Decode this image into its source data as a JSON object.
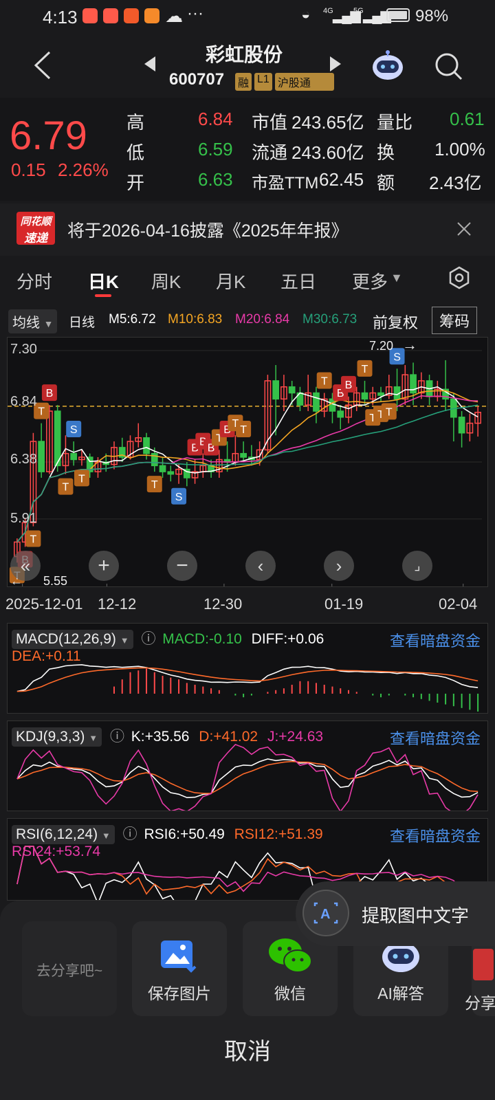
{
  "status_bar": {
    "time": "4:13",
    "dots": "···",
    "net_4g": "4G",
    "net_5g": "5G",
    "battery": "98%"
  },
  "header": {
    "stock_name": "彩虹股份",
    "stock_code": "600707",
    "badges": [
      "融",
      "L1",
      "沪股通"
    ]
  },
  "quote": {
    "price": "6.79",
    "change": "0.15",
    "change_pct": "2.26%",
    "high_label": "高",
    "high": "6.84",
    "low_label": "低",
    "low": "6.59",
    "open_label": "开",
    "open": "6.63",
    "mktcap_label": "市值",
    "mktcap": "243.65亿",
    "float_label": "流通",
    "float": "243.60亿",
    "pe_label": "市盈TTM",
    "pe": "62.45",
    "vol_ratio_label": "量比",
    "vol_ratio": "0.61",
    "turnover_label": "换",
    "turnover": "1.00%",
    "amount_label": "额",
    "amount": "2.43亿"
  },
  "notice": {
    "logo_top": "同花顺",
    "logo_bottom": "速递",
    "text": "将于2026-04-16披露《2025年年报》"
  },
  "tabs": [
    "分时",
    "日K",
    "周K",
    "月K",
    "五日",
    "更多"
  ],
  "ma_bar": {
    "type": "均线",
    "period": "日线",
    "m5": "M5:6.72",
    "m10": "M10:6.83",
    "m20": "M20:6.84",
    "m30": "M30:6.73",
    "adjust": "前复权",
    "chips": "筹码"
  },
  "colors": {
    "up": "#ff4a4a",
    "down": "#35c04a",
    "m5": "#ffffff",
    "m10": "#f5a623",
    "m20": "#e83aa8",
    "m30": "#26a07a",
    "link": "#4a8fe8"
  },
  "chart_data": {
    "type": "candlestick",
    "y_ticks": [
      "7.30",
      "6.84",
      "6.38",
      "5.91",
      "5.55"
    ],
    "ylim": [
      5.45,
      7.35
    ],
    "x_ticks": [
      "2025-12-01",
      "12-12",
      "12-30",
      "01-19",
      "02-04"
    ],
    "high_annot": "7.20",
    "low_annot": "5.55",
    "ref_line": 6.84,
    "candles": [
      [
        5.6,
        5.72,
        5.55,
        5.75
      ],
      [
        5.72,
        5.88,
        5.68,
        5.92
      ],
      [
        5.88,
        6.55,
        5.85,
        6.62
      ],
      [
        6.55,
        6.3,
        6.25,
        6.7
      ],
      [
        6.3,
        6.8,
        6.28,
        6.85
      ],
      [
        6.8,
        6.35,
        6.3,
        6.85
      ],
      [
        6.35,
        6.45,
        6.28,
        6.6
      ],
      [
        6.45,
        6.4,
        6.35,
        6.55
      ],
      [
        6.4,
        6.42,
        6.35,
        6.48
      ],
      [
        6.42,
        6.3,
        6.25,
        6.45
      ],
      [
        6.3,
        6.38,
        6.25,
        6.42
      ],
      [
        6.38,
        6.36,
        6.3,
        6.45
      ],
      [
        6.36,
        6.5,
        6.32,
        6.55
      ],
      [
        6.5,
        6.42,
        6.38,
        6.58
      ],
      [
        6.42,
        6.55,
        6.4,
        6.6
      ],
      [
        6.55,
        6.58,
        6.5,
        6.7
      ],
      [
        6.58,
        6.45,
        6.4,
        6.62
      ],
      [
        6.45,
        6.35,
        6.3,
        6.5
      ],
      [
        6.35,
        6.3,
        6.25,
        6.42
      ],
      [
        6.3,
        6.28,
        6.22,
        6.35
      ],
      [
        6.28,
        6.32,
        6.2,
        6.36
      ],
      [
        6.32,
        6.25,
        6.18,
        6.38
      ],
      [
        6.25,
        6.3,
        6.2,
        6.4
      ],
      [
        6.3,
        6.35,
        6.25,
        6.45
      ],
      [
        6.35,
        6.3,
        6.25,
        6.4
      ],
      [
        6.3,
        6.4,
        6.25,
        6.48
      ],
      [
        6.4,
        6.38,
        6.3,
        6.55
      ],
      [
        6.38,
        6.45,
        6.35,
        6.6
      ],
      [
        6.45,
        6.42,
        6.38,
        6.55
      ],
      [
        6.42,
        6.4,
        6.35,
        6.52
      ],
      [
        6.4,
        6.48,
        6.35,
        6.55
      ],
      [
        6.48,
        7.05,
        6.45,
        7.1
      ],
      [
        7.05,
        6.9,
        6.6,
        7.18
      ],
      [
        6.9,
        7.0,
        6.8,
        7.1
      ],
      [
        7.0,
        6.95,
        6.85,
        7.05
      ],
      [
        6.95,
        6.85,
        6.8,
        7.0
      ],
      [
        6.85,
        6.95,
        6.8,
        7.1
      ],
      [
        6.95,
        6.8,
        6.7,
        7.0
      ],
      [
        6.8,
        6.9,
        6.75,
        6.95
      ],
      [
        6.9,
        6.8,
        6.7,
        6.95
      ],
      [
        6.8,
        6.75,
        6.65,
        6.85
      ],
      [
        6.75,
        6.85,
        6.7,
        6.92
      ],
      [
        6.85,
        6.95,
        6.8,
        7.0
      ],
      [
        6.95,
        6.9,
        6.85,
        7.05
      ],
      [
        6.9,
        6.95,
        6.85,
        7.0
      ],
      [
        6.95,
        6.93,
        6.88,
        7.0
      ],
      [
        6.93,
        7.0,
        6.9,
        7.1
      ],
      [
        7.0,
        6.9,
        6.8,
        7.15
      ],
      [
        6.9,
        7.1,
        6.85,
        7.18
      ],
      [
        7.1,
        6.95,
        6.85,
        7.2
      ],
      [
        6.95,
        7.05,
        6.9,
        7.12
      ],
      [
        7.05,
        6.92,
        6.85,
        7.1
      ],
      [
        6.92,
        6.98,
        6.88,
        7.05
      ],
      [
        6.98,
        6.9,
        6.8,
        7.22
      ],
      [
        6.9,
        6.75,
        6.55,
        6.95
      ],
      [
        6.75,
        6.62,
        6.5,
        6.8
      ],
      [
        6.62,
        6.7,
        6.55,
        6.78
      ],
      [
        6.7,
        6.79,
        6.59,
        6.84
      ]
    ],
    "markers": [
      {
        "label": "T",
        "i": 0,
        "pos": "below"
      },
      {
        "label": "B",
        "i": 1,
        "pos": "below"
      },
      {
        "label": "T",
        "i": 2,
        "pos": "below"
      },
      {
        "label": "T",
        "i": 3,
        "pos": "above"
      },
      {
        "label": "B",
        "i": 4,
        "pos": "above"
      },
      {
        "label": "T",
        "i": 6,
        "pos": "below"
      },
      {
        "label": "S",
        "i": 7,
        "pos": "above"
      },
      {
        "label": "T",
        "i": 8,
        "pos": "below"
      },
      {
        "label": "T",
        "i": 17,
        "pos": "below"
      },
      {
        "label": "S",
        "i": 20,
        "pos": "below"
      },
      {
        "label": "B",
        "i": 22,
        "pos": "above"
      },
      {
        "label": "B",
        "i": 23,
        "pos": "above"
      },
      {
        "label": "B",
        "i": 24,
        "pos": "above"
      },
      {
        "label": "T",
        "i": 25,
        "pos": "above"
      },
      {
        "label": "B",
        "i": 26,
        "pos": "above"
      },
      {
        "label": "T",
        "i": 27,
        "pos": "above"
      },
      {
        "label": "T",
        "i": 28,
        "pos": "above"
      },
      {
        "label": "T",
        "i": 38,
        "pos": "above"
      },
      {
        "label": "B",
        "i": 40,
        "pos": "above"
      },
      {
        "label": "B",
        "i": 41,
        "pos": "above"
      },
      {
        "label": "T",
        "i": 43,
        "pos": "above"
      },
      {
        "label": "T",
        "i": 44,
        "pos": "below"
      },
      {
        "label": "T",
        "i": 45,
        "pos": "below"
      },
      {
        "label": "T",
        "i": 46,
        "pos": "below"
      },
      {
        "label": "S",
        "i": 47,
        "pos": "above"
      }
    ],
    "indicators": {
      "macd": {
        "name": "MACD(12,26,9)",
        "macd": "MACD:-0.10",
        "diff": "DIFF:+0.06",
        "dea": "DEA:+0.11",
        "hist": [
          0.04,
          0.08,
          0.12,
          0.13,
          0.14,
          0.12,
          0.1,
          0.09,
          0.08,
          0.06,
          0.05,
          0.04,
          0.03,
          0.02,
          0.0,
          -0.01,
          -0.02,
          -0.01,
          0.0,
          0.01,
          0.02,
          0.03,
          0.05,
          0.07,
          0.07,
          0.06,
          0.05,
          0.04,
          0.03,
          0.02,
          0.01,
          0.0,
          -0.01,
          -0.02,
          -0.01,
          0.0,
          -0.01,
          -0.02,
          -0.03,
          -0.04,
          -0.05,
          -0.06,
          -0.07,
          -0.08,
          -0.09,
          -0.1
        ]
      },
      "kdj": {
        "name": "KDJ(9,3,3)",
        "k": "K:+35.56",
        "d": "D:+41.02",
        "j": "J:+24.63"
      },
      "rsi": {
        "name": "RSI(6,12,24)",
        "rsi6": "RSI6:+50.49",
        "rsi12": "RSI12:+51.39",
        "rsi24": "RSI24:+53.74"
      },
      "link": "查看暗盘资金"
    }
  },
  "share_sheet": {
    "share_hint": "去分享吧~",
    "items": [
      "保存图片",
      "微信",
      "AI解答",
      "分享"
    ],
    "cancel": "取消",
    "ocr": "提取图中文字"
  }
}
